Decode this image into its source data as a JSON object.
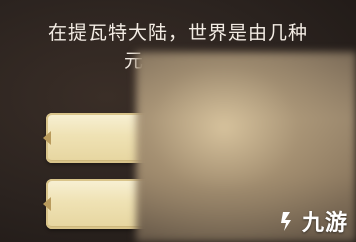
{
  "question": {
    "line1": "在提瓦特大陆，世界是由几种",
    "line2_visible": "元"
  },
  "answers": [
    {
      "label": ""
    },
    {
      "label": ""
    }
  ],
  "watermark": {
    "text": "九游",
    "icon": "9game-logo-icon",
    "color": "#ffffff"
  },
  "colors": {
    "background": "#2b231f",
    "question_text": "#f3ece4",
    "answer_button": "#efe2b4"
  }
}
